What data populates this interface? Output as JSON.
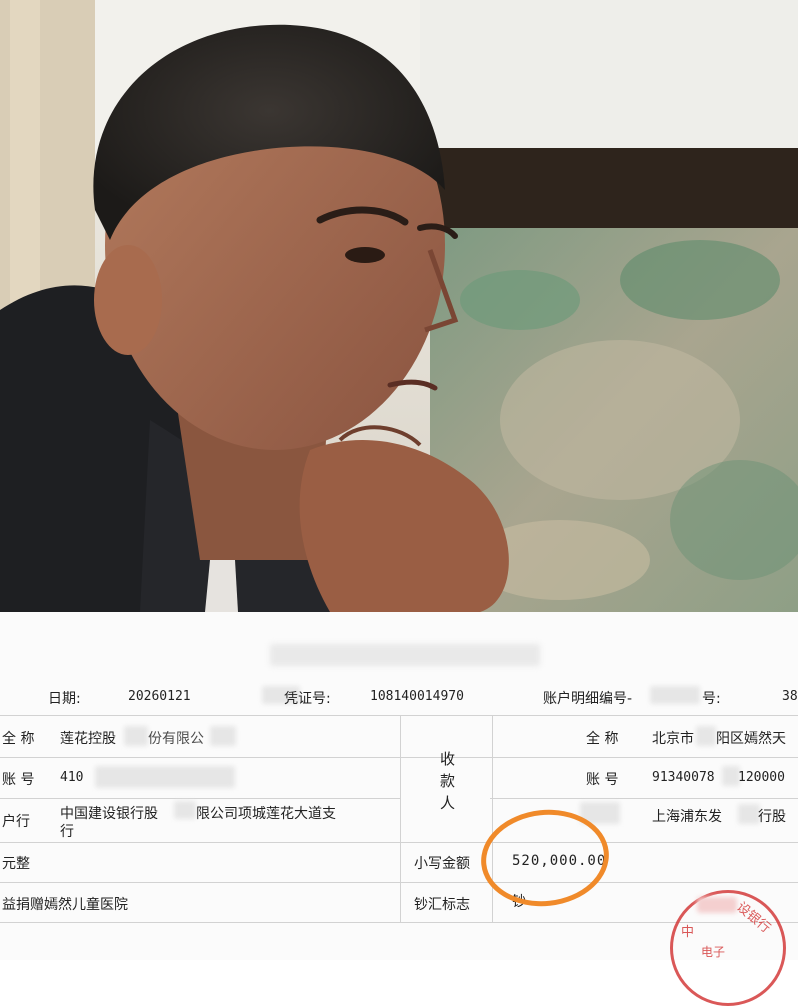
{
  "receipt": {
    "date_label": "日期:",
    "date_value": "20260121",
    "voucher_suffix": "凭证号:",
    "voucher_value": "108140014970",
    "account_detail_label": "账户明细编号-",
    "account_detail_suffix": "号:",
    "account_detail_value": "38",
    "payer": {
      "name_label": "全 称",
      "name_value": "莲花控股",
      "name_value_tail": "份有限公",
      "account_label": "账 号",
      "account_value": "410",
      "bank_label": "户行",
      "bank_value_line1": "中国建设银行股",
      "bank_value_line1_tail": "限公司项城莲花大道支",
      "bank_value_line2": "行"
    },
    "payee_label": "收款人",
    "payee": {
      "name_label": "全 称",
      "name_value": "北京市",
      "name_value_tail": "阳区嫣然天",
      "account_label": "账 号",
      "account_value": "91340078",
      "account_value_tail": "120000",
      "bank_value": "上海浦东发",
      "bank_value_tail": "行股"
    },
    "amount_words_label": "元整",
    "amount_small_label": "小写金额",
    "amount_value": "520,000.00",
    "purpose_value": "益捐赠嫣然儿童医院",
    "currency_flag_label": "钞汇标志",
    "currency_flag_value": "钞",
    "stamp_text_top": "中",
    "stamp_text_right": "设银行",
    "stamp_text_bottom": "电子"
  },
  "colors": {
    "highlight_circle": "#f08a2a",
    "stamp_red": "#d43b3b"
  }
}
